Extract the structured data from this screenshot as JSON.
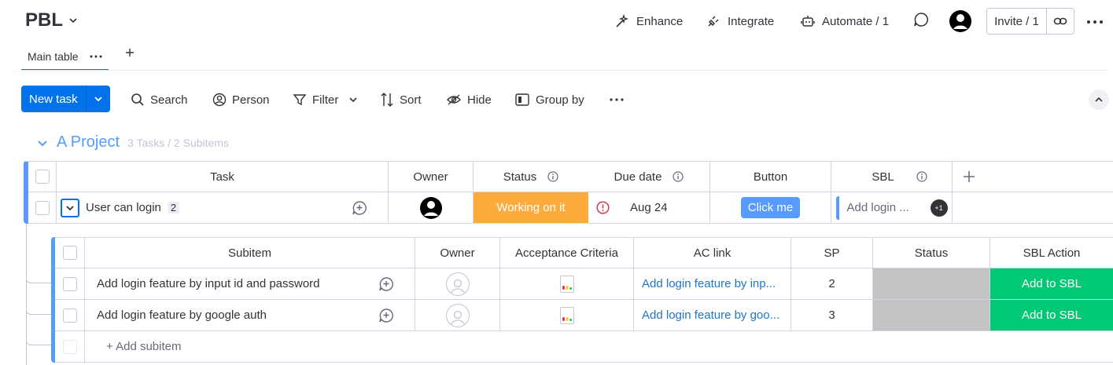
{
  "header": {
    "board_title": "PBL",
    "enhance": "Enhance",
    "integrate": "Integrate",
    "automate": "Automate / 1",
    "invite": "Invite / 1"
  },
  "tabs": {
    "main": "Main table"
  },
  "toolbar": {
    "new_task": "New task",
    "search": "Search",
    "person": "Person",
    "filter": "Filter",
    "sort": "Sort",
    "hide": "Hide",
    "group_by": "Group by"
  },
  "group": {
    "title": "A Project",
    "count": "3 Tasks / 2 Subitems",
    "color": "#579bfc"
  },
  "main_table": {
    "columns": {
      "task": "Task",
      "owner": "Owner",
      "status": "Status",
      "due_date": "Due date",
      "button": "Button",
      "sbl": "SBL"
    },
    "row": {
      "task": "User can login",
      "subitem_count": "2",
      "status": "Working on it",
      "status_color": "#fdab3d",
      "due_date": "Aug 24",
      "button_label": "Click me",
      "sbl_placeholder": "Add login ...",
      "sbl_extra": "+1"
    }
  },
  "sub_table": {
    "columns": {
      "subitem": "Subitem",
      "owner": "Owner",
      "acceptance": "Acceptance Criteria",
      "ac_link": "AC link",
      "sp": "SP",
      "status": "Status",
      "sbl_action": "SBL Action"
    },
    "rows": [
      {
        "name": "Add login feature by input id and password",
        "ac_link": "Add login feature by inp...",
        "sp": "2",
        "action": "Add to SBL"
      },
      {
        "name": "Add login feature by google auth",
        "ac_link": "Add login feature by goo...",
        "sp": "3",
        "action": "Add to SBL"
      }
    ],
    "add_subitem": "+ Add subitem"
  }
}
